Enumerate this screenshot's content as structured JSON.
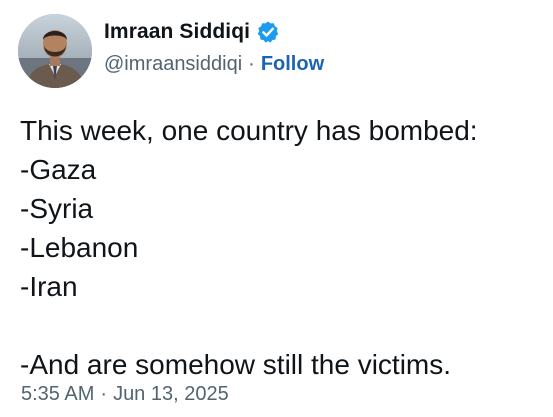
{
  "author": {
    "display_name": "Imraan Siddiqi",
    "handle": "@imraansiddiqi",
    "separator": "·",
    "follow_label": "Follow",
    "verified": true,
    "verified_color": "#1d9bf0"
  },
  "post": {
    "lines": [
      "This week, one country has bombed:",
      "-Gaza",
      "-Syria",
      "-Lebanon",
      "-Iran",
      "",
      "-And are somehow still the victims."
    ]
  },
  "meta": {
    "time": "5:35 AM",
    "separator": "·",
    "date": "Jun 13, 2025"
  },
  "colors": {
    "text": "#0f1419",
    "secondary": "#536471",
    "link": "#1d65b0"
  }
}
